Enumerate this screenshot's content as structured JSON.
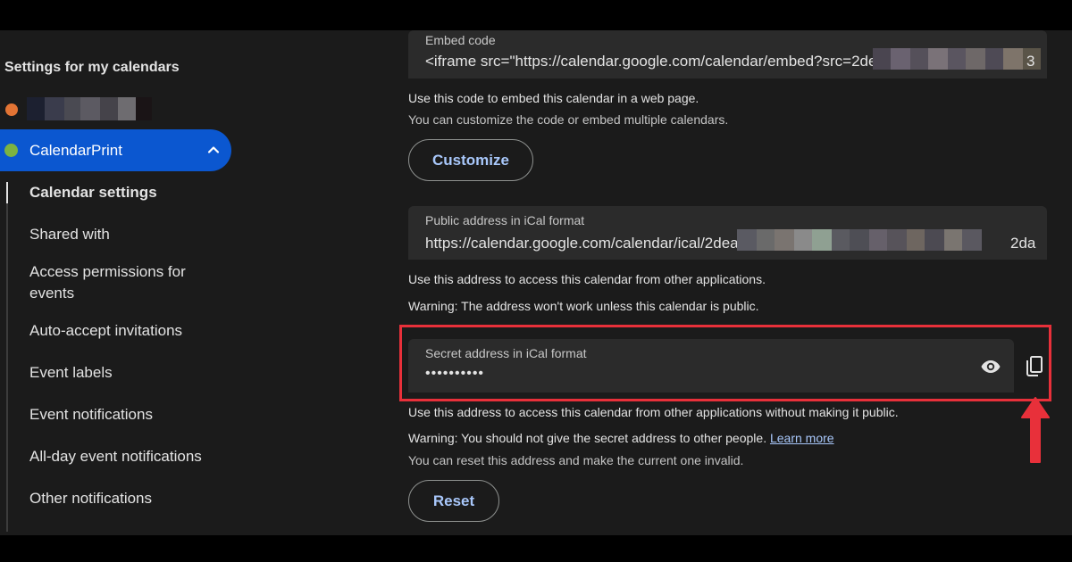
{
  "sidebar": {
    "title": "Settings for my calendars",
    "active_calendar": "CalendarPrint",
    "items": [
      {
        "label": "Calendar settings"
      },
      {
        "label": "Shared with"
      },
      {
        "label": "Access permissions for events"
      },
      {
        "label": "Auto-accept invitations"
      },
      {
        "label": "Event labels"
      },
      {
        "label": "Event notifications"
      },
      {
        "label": "All-day event notifications"
      },
      {
        "label": "Other notifications"
      }
    ]
  },
  "embed": {
    "label": "Embed code",
    "value": "<iframe src=\"https://calendar.google.com/calendar/embed?src=2de",
    "tail": "3",
    "help1": "Use this code to embed this calendar in a web page.",
    "help2": "You can customize the code or embed multiple calendars.",
    "customize_label": "Customize"
  },
  "public_ical": {
    "label": "Public address in iCal format",
    "value": "https://calendar.google.com/calendar/ical/2dea",
    "tail": "2da",
    "help1": "Use this address to access this calendar from other applications.",
    "help2": "Warning: The address won't work unless this calendar is public."
  },
  "secret_ical": {
    "label": "Secret address in iCal format",
    "value": "••••••••••",
    "help1": "Use this address to access this calendar from other applications without making it public.",
    "help2": "Warning: You should not give the secret address to other people.",
    "learn_more": "Learn more",
    "help3": "You can reset this address and make the current one invalid.",
    "reset_label": "Reset"
  },
  "icons": {
    "show": "eye-icon",
    "copy": "copy-icon",
    "collapse": "chevron-up-icon"
  },
  "colors": {
    "accent": "#0b57d0",
    "link": "#a8c7fa",
    "highlight": "#e8303a"
  }
}
